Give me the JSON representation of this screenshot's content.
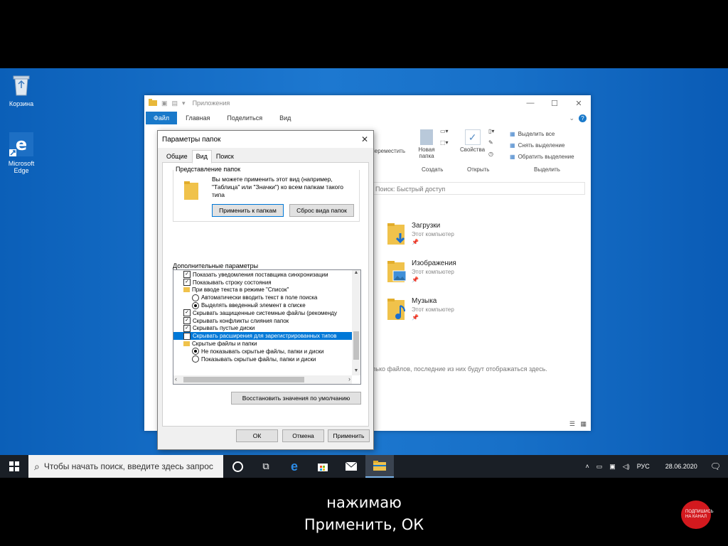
{
  "desktop": {
    "icons": [
      {
        "name": "recycle-bin",
        "label": "Корзина"
      },
      {
        "name": "microsoft-edge",
        "label": "Microsoft Edge"
      }
    ]
  },
  "explorer": {
    "title": "Приложения",
    "tabs": [
      "Файл",
      "Главная",
      "Поделиться",
      "Вид"
    ],
    "ribbon": {
      "new_folder": "Новая папка",
      "new_label": "Создать",
      "properties": "Свойства",
      "open_label": "Открыть",
      "select_all": "Выделить все",
      "select_none": "Снять выделение",
      "invert": "Обратить выделение",
      "select_label": "Выделить",
      "move_label": "Переместить"
    },
    "search_placeholder": "Поиск: Быстрый доступ",
    "quick_access": [
      {
        "name": "Загрузки",
        "sub": "Этот компьютер"
      },
      {
        "name": "Изображения",
        "sub": "Этот компьютер"
      },
      {
        "name": "Музыка",
        "sub": "Этот компьютер"
      }
    ],
    "recent_text": "лько файлов, последние из них будут отображаться здесь."
  },
  "dialog": {
    "title": "Параметры папок",
    "tabs": [
      "Общие",
      "Вид",
      "Поиск"
    ],
    "folder_views_label": "Представление папок",
    "folder_views_text": "Вы можете применить этот вид (например, \"Таблица\" или \"Значки\") ко всем папкам такого типа",
    "apply_to_folders": "Применить к папкам",
    "reset_folders": "Сброс вида папок",
    "advanced_label": "Дополнительные параметры",
    "settings": [
      {
        "type": "check",
        "checked": true,
        "indent": 0,
        "text": "Показать уведомления поставщика синхронизации"
      },
      {
        "type": "check",
        "checked": true,
        "indent": 0,
        "text": "Показывать строку состояния"
      },
      {
        "type": "folder",
        "indent": 0,
        "text": "При вводе текста в режиме \"Список\""
      },
      {
        "type": "radio",
        "checked": false,
        "indent": 1,
        "text": "Автоматически вводить текст в поле поиска"
      },
      {
        "type": "radio",
        "checked": true,
        "indent": 1,
        "text": "Выделять введенный элемент в списке"
      },
      {
        "type": "check",
        "checked": true,
        "indent": 0,
        "text": "Скрывать защищенные системные файлы (рекоменду"
      },
      {
        "type": "check",
        "checked": true,
        "indent": 0,
        "text": "Скрывать конфликты слияния папок"
      },
      {
        "type": "check",
        "checked": true,
        "indent": 0,
        "text": "Скрывать пустые диски"
      },
      {
        "type": "check",
        "checked": false,
        "indent": 0,
        "highlight": true,
        "text": "Скрывать расширения для зарегистрированных типов"
      },
      {
        "type": "folder",
        "indent": 0,
        "text": "Скрытые файлы и папки"
      },
      {
        "type": "radio",
        "checked": true,
        "indent": 1,
        "text": "Не показывать скрытые файлы, папки и диски"
      },
      {
        "type": "radio",
        "checked": false,
        "indent": 1,
        "text": "Показывать скрытые файлы, папки и диски"
      }
    ],
    "restore_defaults": "Восстановить значения по умолчанию",
    "ok": "ОК",
    "cancel": "Отмена",
    "apply": "Применить"
  },
  "taskbar": {
    "search_placeholder": "Чтобы начать поиск, введите здесь запрос",
    "lang": "РУС",
    "date": "28.06.2020"
  },
  "overlay": {
    "caption_line1": "нажимаю",
    "caption_line2": "Применить, ОК",
    "subscribe": "ПОДПИШИСЬ НА КАНАЛ"
  },
  "colors": {
    "desktop": "#1770c8",
    "accent": "#0078d7",
    "taskbar": "#1a1f26",
    "subscribe": "#d3191e"
  }
}
